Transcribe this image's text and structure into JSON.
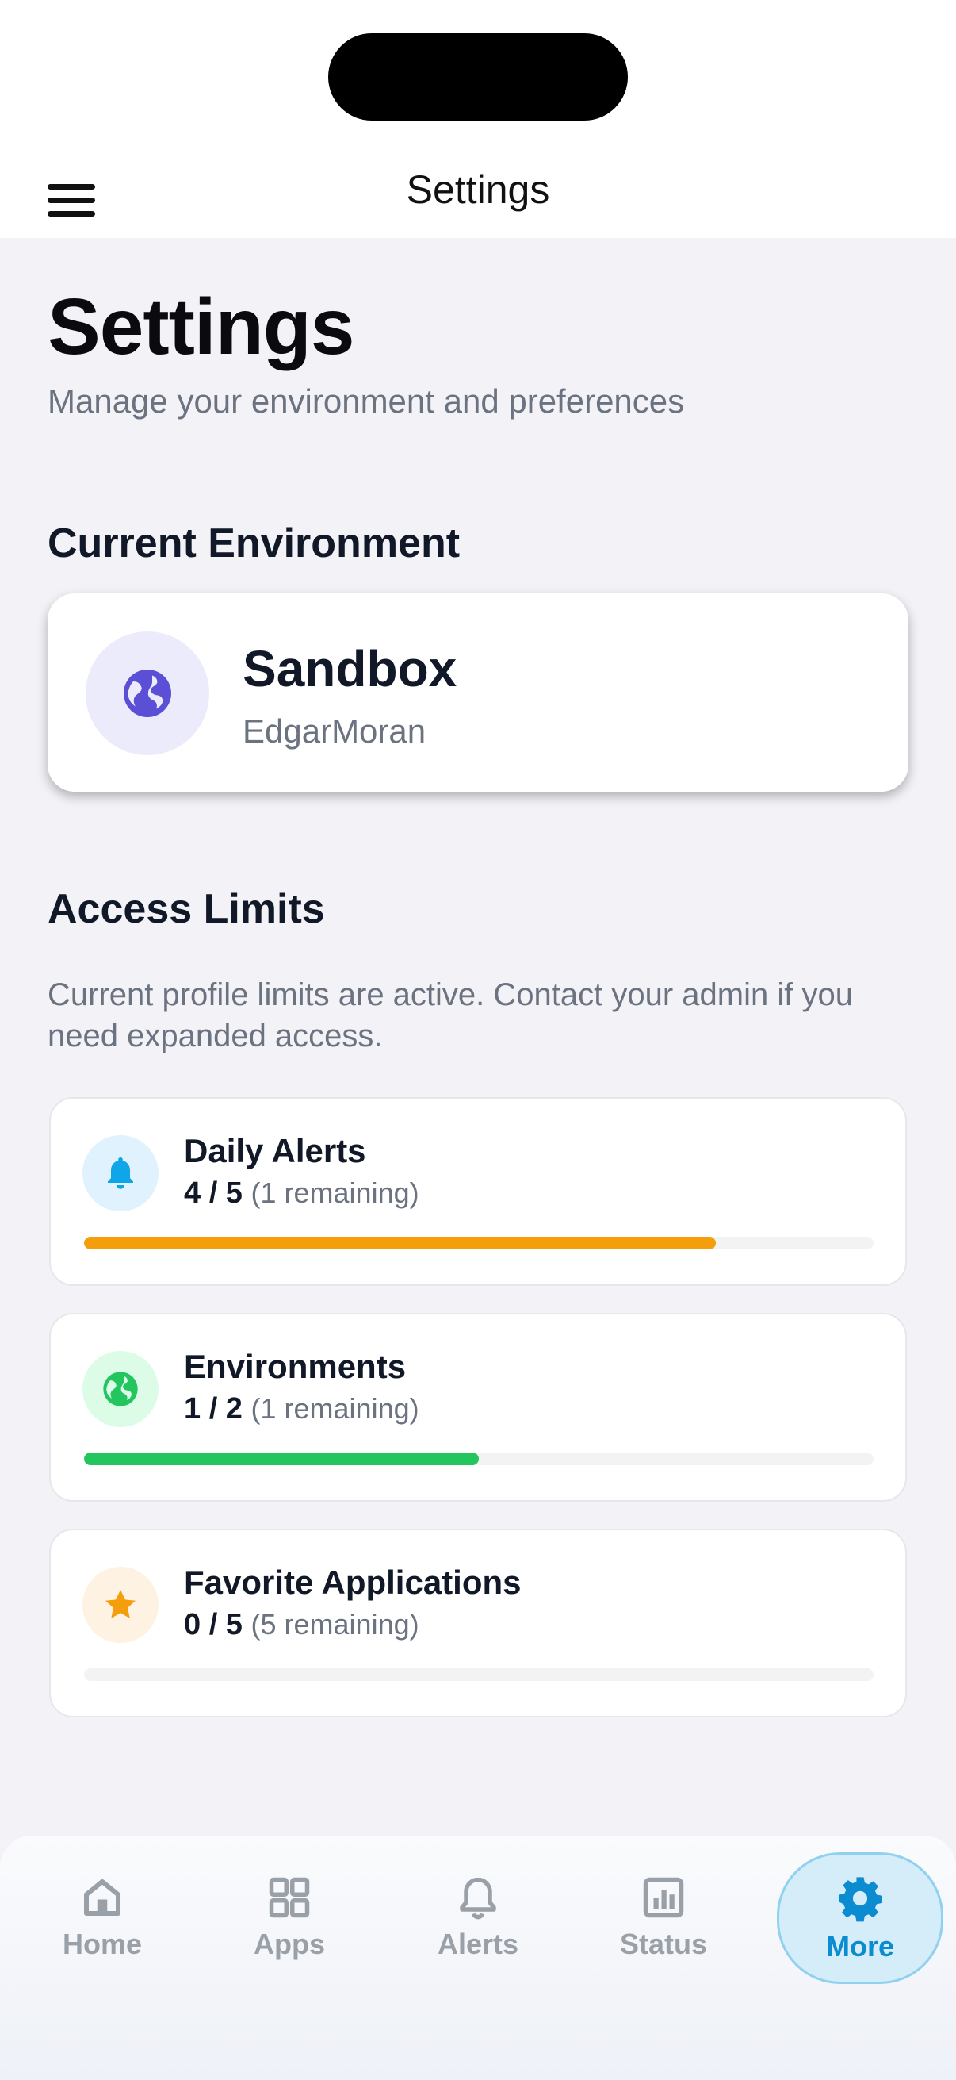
{
  "header": {
    "title": "Settings"
  },
  "page": {
    "title": "Settings",
    "subtitle": "Manage your environment and preferences"
  },
  "environment": {
    "section_title": "Current Environment",
    "name": "Sandbox",
    "user": "EdgarMoran",
    "icon": "globe-icon"
  },
  "limits": {
    "section_title": "Access Limits",
    "description": "Current profile limits are active. Contact your admin if you need expanded access.",
    "items": [
      {
        "label": "Daily Alerts",
        "used": "4 / 5",
        "remaining": "(1 remaining)",
        "fraction": 0.8,
        "icon": "bell-icon",
        "color": "#f59e0b",
        "icon_color": "#0ea5e9",
        "icon_bg": "#e0f2fe"
      },
      {
        "label": "Environments",
        "used": "1 / 2",
        "remaining": "(1 remaining)",
        "fraction": 0.5,
        "icon": "globe-icon",
        "color": "#22c55e",
        "icon_color": "#22c55e",
        "icon_bg": "#dcfce7"
      },
      {
        "label": "Favorite Applications",
        "used": "0 / 5",
        "remaining": "(5 remaining)",
        "fraction": 0.0,
        "icon": "star-icon",
        "color": "#f59e0b",
        "icon_color": "#f59e0b",
        "icon_bg": "#fef3e2"
      }
    ]
  },
  "tabbar": {
    "items": [
      {
        "label": "Home",
        "icon": "home-icon"
      },
      {
        "label": "Apps",
        "icon": "grid-icon"
      },
      {
        "label": "Alerts",
        "icon": "bell-icon"
      },
      {
        "label": "Status",
        "icon": "bar-chart-icon"
      },
      {
        "label": "More",
        "icon": "gear-icon",
        "active": true
      }
    ]
  },
  "colors": {
    "accent": "#0b8bd0",
    "environment_icon": "#5b4fd6"
  }
}
